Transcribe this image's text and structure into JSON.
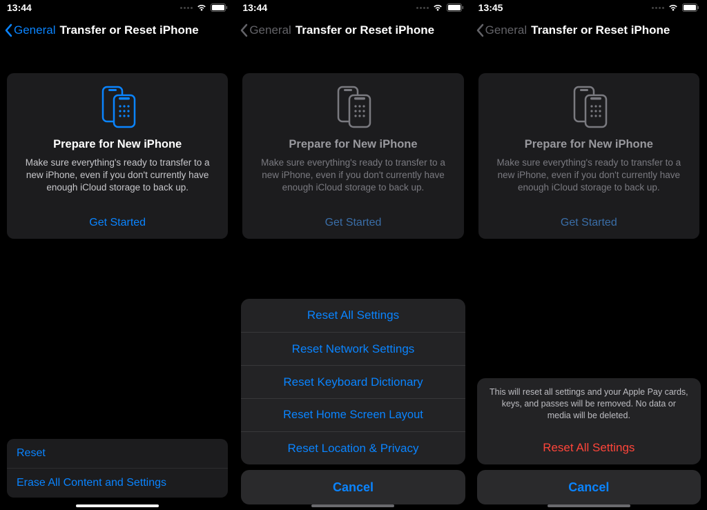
{
  "screens": [
    {
      "time": "13:44",
      "back": "General",
      "title": "Transfer or Reset iPhone",
      "card_title": "Prepare for New iPhone",
      "card_desc": "Make sure everything's ready to transfer to a new iPhone, even if you don't currently have enough iCloud storage to back up.",
      "get_started": "Get Started",
      "reset": "Reset",
      "erase": "Erase All Content and Settings"
    },
    {
      "time": "13:44",
      "back": "General",
      "title": "Transfer or Reset iPhone",
      "card_title": "Prepare for New iPhone",
      "card_desc": "Make sure everything's ready to transfer to a new iPhone, even if you don't currently have enough iCloud storage to back up.",
      "get_started": "Get Started",
      "sheet": {
        "items": [
          "Reset All Settings",
          "Reset Network Settings",
          "Reset Keyboard Dictionary",
          "Reset Home Screen Layout",
          "Reset Location & Privacy"
        ],
        "cancel": "Cancel"
      }
    },
    {
      "time": "13:45",
      "back": "General",
      "title": "Transfer or Reset iPhone",
      "card_title": "Prepare for New iPhone",
      "card_desc": "Make sure everything's ready to transfer to a new iPhone, even if you don't currently have enough iCloud storage to back up.",
      "get_started": "Get Started",
      "confirm": {
        "message": "This will reset all settings and your Apple Pay cards, keys, and passes will be removed. No data or media will be deleted.",
        "action": "Reset All Settings",
        "cancel": "Cancel"
      }
    }
  ]
}
